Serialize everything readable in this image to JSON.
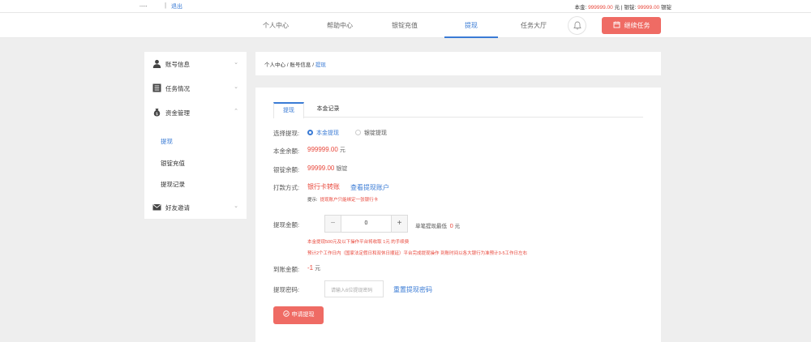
{
  "topbar": {
    "username": ".....",
    "separator": "|",
    "logout": "退出",
    "balance_label": "本金:",
    "balance_value": "999999.00",
    "balance_unit": "元",
    "divider": "|",
    "ingot_label": "银锭:",
    "ingot_value": "99999.00",
    "ingot_unit": "银锭"
  },
  "nav": {
    "items": [
      "个人中心",
      "帮助中心",
      "银锭充值",
      "提现",
      "任务大厅"
    ],
    "active_index": 3,
    "cta_label": "继续任务"
  },
  "sidebar": {
    "account": "账号信息",
    "tasks": "任务情况",
    "funds": "资金管理",
    "sub": [
      "提现",
      "银锭充值",
      "提现记录"
    ],
    "active_sub": 0,
    "invite": "好友邀请"
  },
  "breadcrumb": {
    "home": "个人中心",
    "sep": " / ",
    "account": "账号信息",
    "current": "提现"
  },
  "panel": {
    "tabs": [
      "提现",
      "本金记录"
    ],
    "active_tab": 0,
    "choose_label": "选择提现:",
    "option_principal": "本金提现",
    "option_ingot": "银锭提现",
    "principal_label": "本金余额:",
    "principal_value": "999999.00",
    "principal_unit": "元",
    "ingot_label": "银锭余额:",
    "ingot_value": "99999.00",
    "ingot_unit": "银锭",
    "payment_label": "打款方式:",
    "payment_value": "银行卡转账",
    "view_account_link": "查看提现账户",
    "tip_key": "提示:",
    "tip_text": "提现账户只能绑定一张银行卡",
    "amount_label": "提现金额:",
    "amount_value": "0",
    "minus": "−",
    "plus": "+",
    "min_label": "单笔提现最低",
    "min_value": "0",
    "min_unit": "元",
    "fee_note": "本金提现500元及以下操作平台将收取 1元 的手续费",
    "time_note": "预计2个工作日内（国家法定假日和双休日顺延）平台完成提现操作 到账时间以各大银行为准预计3-5工作日左右",
    "arrive_label": "到账金额:",
    "arrive_value": "-1",
    "arrive_unit": "元",
    "pwd_label": "提现密码:",
    "pwd_placeholder": "请输入6位提现密码",
    "reset_pwd_link": "重置提现密码",
    "apply_label": "申请提现"
  },
  "colors": {
    "accent": "#3a7bd5",
    "danger": "#e8473b",
    "cta": "#ef6b64",
    "background": "#eeeeee"
  }
}
